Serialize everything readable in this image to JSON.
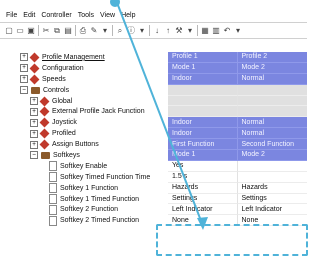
{
  "menu": [
    "File",
    "Edit",
    "Controller",
    "Tools",
    "View",
    "Help"
  ],
  "toolbar_icons": [
    "new-icon",
    "open-icon",
    "save-icon",
    "sep",
    "cut-icon",
    "copy-icon",
    "paste-icon",
    "sep",
    "print-icon",
    "paint-icon",
    "dropdown-icon",
    "sep",
    "search-icon",
    "info-icon",
    "dropdown-icon",
    "sep",
    "download-icon",
    "upload-icon",
    "wrench-icon",
    "dropdown-icon",
    "sep",
    "grid-icon",
    "table-icon",
    "undo-icon",
    "dropdown-icon"
  ],
  "tree": [
    {
      "label": "Profile Management",
      "indent": 0,
      "expander": "+",
      "icon": "diamond",
      "link": true
    },
    {
      "label": "Configuration",
      "indent": 0,
      "expander": "+",
      "icon": "diamond"
    },
    {
      "label": "Speeds",
      "indent": 0,
      "expander": "+",
      "icon": "diamond"
    },
    {
      "label": "Controls",
      "indent": 0,
      "expander": "-",
      "icon": "folder"
    },
    {
      "label": "Global",
      "indent": 1,
      "expander": "+",
      "icon": "diamond"
    },
    {
      "label": "External Profile Jack Function",
      "indent": 1,
      "expander": "+",
      "icon": "diamond"
    },
    {
      "label": "Joystick",
      "indent": 1,
      "expander": "+",
      "icon": "diamond"
    },
    {
      "label": "Profiled",
      "indent": 1,
      "expander": "+",
      "icon": "diamond"
    },
    {
      "label": "Assign Buttons",
      "indent": 1,
      "expander": "+",
      "icon": "diamond"
    },
    {
      "label": "Softkeys",
      "indent": 1,
      "expander": "-",
      "icon": "folder"
    },
    {
      "label": "Softkey Enable",
      "indent": 2,
      "expander": "",
      "icon": "doc"
    },
    {
      "label": "Softkey Timed Function Time",
      "indent": 2,
      "expander": "",
      "icon": "doc"
    },
    {
      "label": "Softkey 1 Function",
      "indent": 2,
      "expander": "",
      "icon": "doc"
    },
    {
      "label": "Softkey 1 Timed Function",
      "indent": 2,
      "expander": "",
      "icon": "doc"
    },
    {
      "label": "Softkey 2 Function",
      "indent": 2,
      "expander": "",
      "icon": "doc"
    },
    {
      "label": "Softkey 2 Timed Function",
      "indent": 2,
      "expander": "",
      "icon": "doc"
    }
  ],
  "grid": [
    {
      "style": "blue",
      "cells": [
        "Profile 1",
        "Profile 2"
      ]
    },
    {
      "style": "blue",
      "cells": [
        "Mode 1",
        "Mode 2"
      ]
    },
    {
      "style": "blue",
      "cells": [
        "Indoor",
        "Normal"
      ]
    },
    {
      "style": "gray",
      "cells": [
        "",
        ""
      ]
    },
    {
      "style": "gray",
      "cells": [
        "",
        ""
      ]
    },
    {
      "style": "gray",
      "cells": [
        "",
        ""
      ]
    },
    {
      "style": "blue",
      "cells": [
        "Indoor",
        "Normal"
      ]
    },
    {
      "style": "blue",
      "cells": [
        "Indoor",
        "Normal"
      ]
    },
    {
      "style": "blue",
      "cells": [
        "First Function",
        "Second Function"
      ]
    },
    {
      "style": "blue",
      "cells": [
        "Mode 1",
        "Mode 2"
      ]
    },
    {
      "style": "white",
      "cells": [
        "Yes",
        ""
      ]
    },
    {
      "style": "white",
      "cells": [
        "1.5 s",
        ""
      ]
    },
    {
      "style": "white",
      "cells": [
        "Hazards",
        "Hazards"
      ]
    },
    {
      "style": "white",
      "cells": [
        "Settings",
        "Settings"
      ]
    },
    {
      "style": "white",
      "cells": [
        "Left Indicator",
        "Left Indicator"
      ]
    },
    {
      "style": "white",
      "cells": [
        "None",
        "None"
      ]
    }
  ],
  "colors": {
    "header_blue": "#7b86e0",
    "highlight_dashed": "#4fb3d9",
    "row_gray": "#e0e0e0"
  }
}
